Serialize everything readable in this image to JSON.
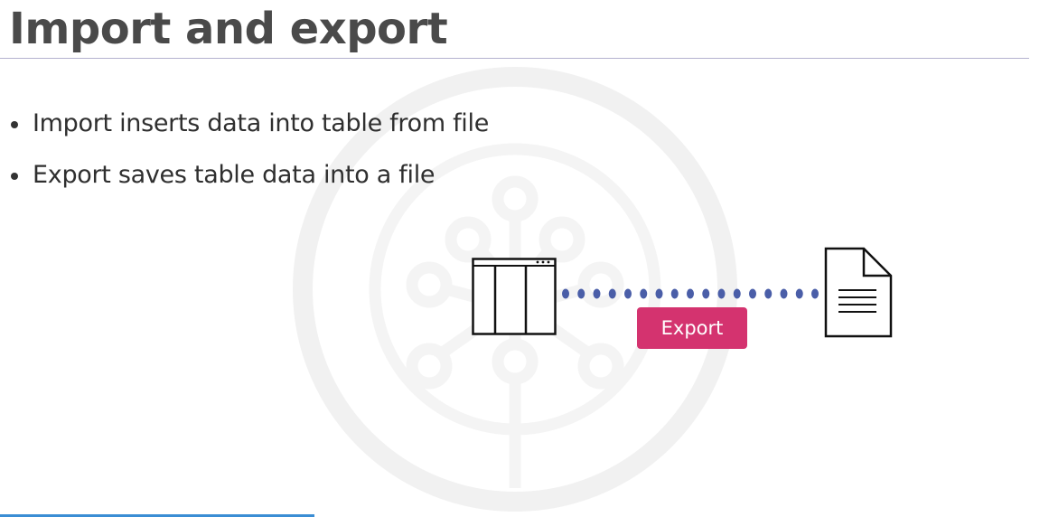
{
  "slide": {
    "title": "Import and export",
    "bullets": [
      "Import inserts data into table from file",
      "Export saves table data into a file"
    ],
    "diagram": {
      "source_icon": "table-icon",
      "target_icon": "document-icon",
      "connector_icon": "dotted-line",
      "label": "Export"
    }
  },
  "colors": {
    "title": "#4a4a4a",
    "text": "#2f2f2f",
    "badge": "#d4336f",
    "connector": "#4a5ea8",
    "rule": "#b4b2cf",
    "progress": "#3a8dd4"
  }
}
